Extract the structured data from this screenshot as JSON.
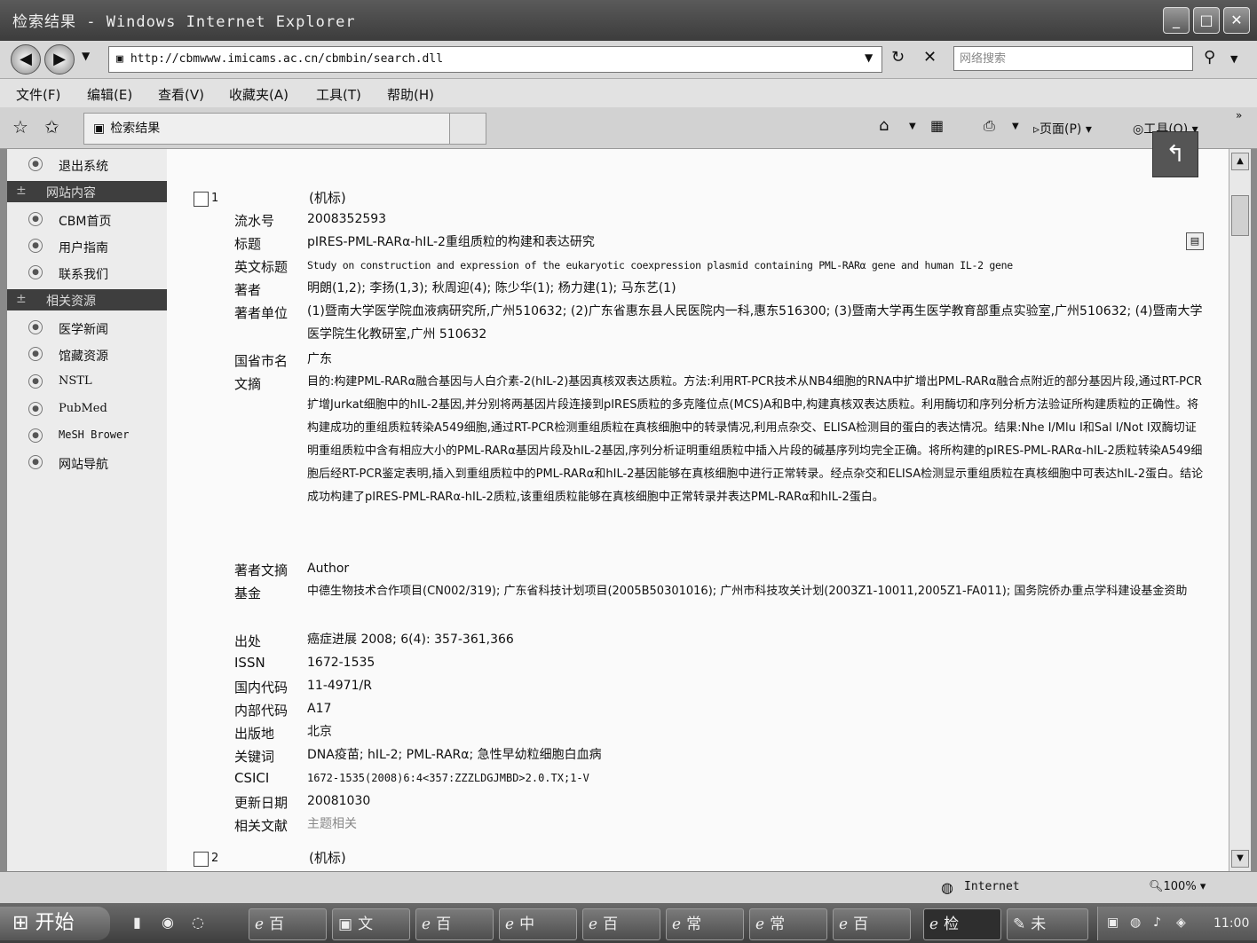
{
  "window": {
    "title": "检索结果 - Windows Internet Explorer"
  },
  "nav": {
    "url": "http://cbmwww.imicams.ac.cn/cbmbin/search.dll",
    "search_placeholder": "网络搜索"
  },
  "menu": [
    "文件(F)",
    "编辑(E)",
    "查看(V)",
    "收藏夹(A)",
    "工具(T)",
    "帮助(H)"
  ],
  "tab": {
    "title": "检索结果"
  },
  "commands": {
    "page": "页面(P)",
    "tools": "工具(O)"
  },
  "sidebar": {
    "logout": "退出系统",
    "section1": "网站内容",
    "items1": [
      "CBM首页",
      "用户指南",
      "联系我们"
    ],
    "section2": "相关资源",
    "items2": [
      "医学新闻",
      "馆藏资源",
      "NSTL",
      "PubMed",
      "MeSH Brower",
      "网站导航"
    ]
  },
  "record": {
    "number": "1",
    "type": "(机标)",
    "fields": [
      {
        "label": "流水号",
        "value": "2008352593"
      },
      {
        "label": "标题",
        "value": "pIRES-PML-RARα-hIL-2重组质粒的构建和表达研究"
      },
      {
        "label": "英文标题",
        "value": "Study on construction and expression of the eukaryotic coexpression plasmid containing PML-RARα gene and human IL-2 gene"
      },
      {
        "label": "著者",
        "value": "明朗(1,2); 李扬(1,3); 秋周迎(4); 陈少华(1); 杨力建(1); 马东艺(1)"
      },
      {
        "label": "著者单位",
        "value": "(1)暨南大学医学院血液病研究所,广州510632; (2)广东省惠东县人民医院内一科,惠东516300; (3)暨南大学再生医学教育部重点实验室,广州510632; (4)暨南大学医学院生化教研室,广州 510632"
      },
      {
        "label": "国省市名",
        "value": "广东"
      },
      {
        "label": "文摘",
        "value": "目的:构建PML-RARα融合基因与人白介素-2(hIL-2)基因真核双表达质粒。方法:利用RT-PCR技术从NB4细胞的RNA中扩增出PML-RARα融合点附近的部分基因片段,通过RT-PCR扩增Jurkat细胞中的hIL-2基因,并分别将两基因片段连接到pIRES质粒的多克隆位点(MCS)A和B中,构建真核双表达质粒。利用酶切和序列分析方法验证所构建质粒的正确性。将构建成功的重组质粒转染A549细胞,通过RT-PCR检测重组质粒在真核细胞中的转录情况,利用点杂交、ELISA检测目的蛋白的表达情况。结果:Nhe I/Mlu I和Sal I/Not I双酶切证明重组质粒中含有相应大小的PML-RARα基因片段及hIL-2基因,序列分析证明重组质粒中插入片段的碱基序列均完全正确。将所构建的pIRES-PML-RARα-hIL-2质粒转染A549细胞后经RT-PCR鉴定表明,插入到重组质粒中的PML-RARα和hIL-2基因能够在真核细胞中进行正常转录。经点杂交和ELISA检测显示重组质粒在真核细胞中可表达hIL-2蛋白。结论成功构建了pIRES-PML-RARα-hIL-2质粒,该重组质粒能够在真核细胞中正常转录并表达PML-RARα和hIL-2蛋白。"
      },
      {
        "label": "著者文摘",
        "value": "Author"
      },
      {
        "label": "基金",
        "value": "中德生物技术合作项目(CN002/319); 广东省科技计划项目(2005B50301016); 广州市科技攻关计划(2003Z1-10011,2005Z1-FA011); 国务院侨办重点学科建设基金资助"
      },
      {
        "label": "出处",
        "value": "癌症进展  2008; 6(4): 357-361,366"
      },
      {
        "label": "ISSN",
        "value": "1672-1535"
      },
      {
        "label": "国内代码",
        "value": "11-4971/R"
      },
      {
        "label": "内部代码",
        "value": "A17"
      },
      {
        "label": "出版地",
        "value": "北京"
      },
      {
        "label": "关键词",
        "value": "DNA疫苗; hIL-2; PML-RARα; 急性早幼粒细胞白血病"
      },
      {
        "label": "CSICI",
        "value": "1672-1535(2008)6:4<357:ZZZLDGJMBD>2.0.TX;1-V"
      },
      {
        "label": "更新日期",
        "value": "20081030"
      },
      {
        "label": "相关文献",
        "value": "主题相关"
      }
    ]
  },
  "record2": {
    "number": "2",
    "type": "(机标)"
  },
  "status": {
    "zone": "Internet",
    "zoom": "100%"
  },
  "taskbar": {
    "start": "开始",
    "buttons": [
      "百",
      "文",
      "百",
      "中",
      "百",
      "常",
      "常",
      "百",
      "检",
      "未"
    ],
    "clock": "11:00"
  }
}
